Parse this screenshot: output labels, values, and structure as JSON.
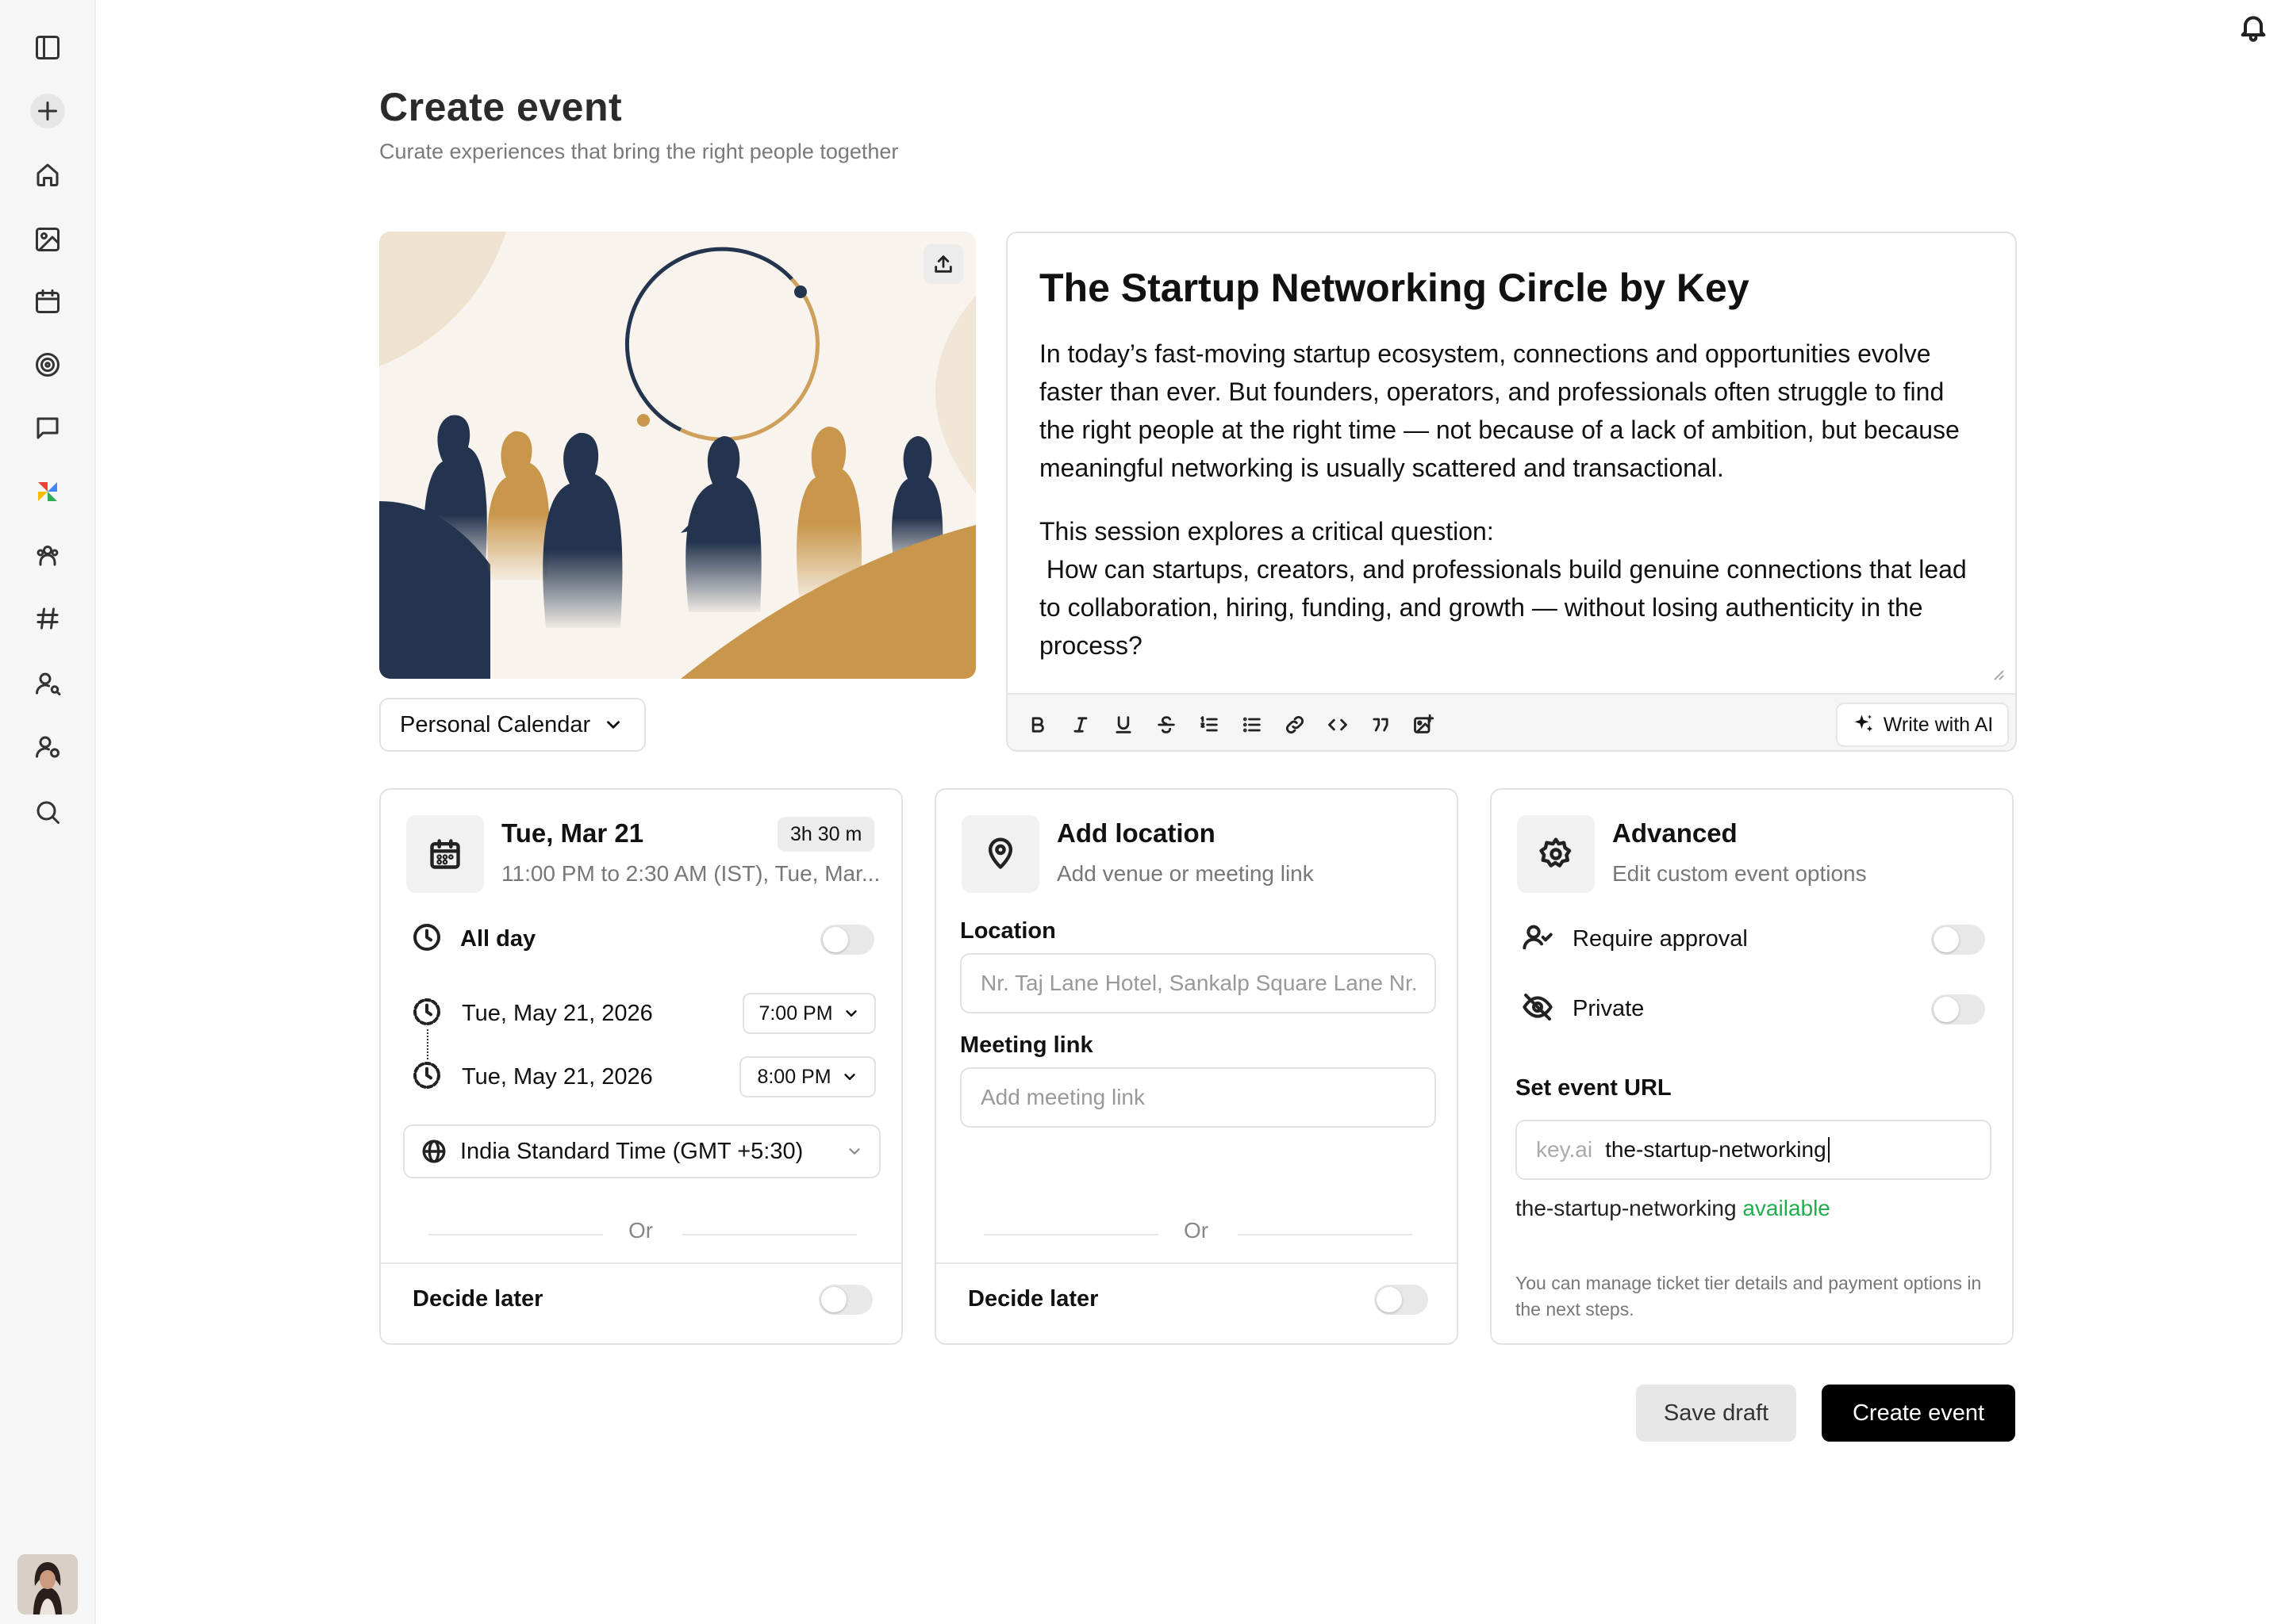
{
  "sidebar": {
    "items": [
      {
        "icon": "sidebar-panel-icon"
      },
      {
        "icon": "plus-icon"
      },
      {
        "icon": "home-icon"
      },
      {
        "icon": "image-icon"
      },
      {
        "icon": "calendar-icon"
      },
      {
        "icon": "target-icon"
      },
      {
        "icon": "chat-icon"
      },
      {
        "icon": "apps-icon"
      },
      {
        "icon": "community-icon"
      },
      {
        "icon": "hashtag-icon"
      },
      {
        "icon": "user-search-icon"
      },
      {
        "icon": "user-settings-icon"
      },
      {
        "icon": "search-icon"
      }
    ]
  },
  "header": {
    "title": "Create event",
    "subtitle": "Curate experiences that bring the right people together"
  },
  "calendar_select": {
    "value": "Personal Calendar"
  },
  "editor": {
    "title": "The Startup Networking Circle by Key",
    "paragraphs": [
      "In today’s fast-moving startup ecosystem, connections and opportunities evolve faster than ever. But founders, operators, and professionals often struggle to find the right people at the right time — not because of a lack of ambition, but because meaningful networking is usually scattered and transactional.",
      "This session explores a critical question:\n How can startups, creators, and professionals build genuine connections that lead to collaboration, hiring, funding, and growth — without losing authenticity in the process?"
    ],
    "ai_button": "Write with AI"
  },
  "datetime": {
    "heading": "Tue, Mar 21",
    "summary": "11:00 PM to 2:30 AM (IST), Tue, Mar...",
    "duration": "3h 30 m",
    "all_day_label": "All day",
    "start_date": "Tue, May 21, 2026",
    "start_time": "7:00 PM",
    "end_date": "Tue, May 21, 2026",
    "end_time": "8:00 PM",
    "timezone": "India Standard Time (GMT +5:30)",
    "or_label": "Or",
    "decide_later": "Decide later"
  },
  "location": {
    "heading": "Add location",
    "subtitle": "Add venue or meeting link",
    "location_label": "Location",
    "location_placeholder": "Nr. Taj Lane Hotel, Sankalp Square Lane Nr.",
    "meeting_label": "Meeting link",
    "meeting_placeholder": "Add meeting link",
    "or_label": "Or",
    "decide_later": "Decide later"
  },
  "advanced": {
    "heading": "Advanced",
    "subtitle": "Edit custom event options",
    "require_approval": "Require approval",
    "private": "Private",
    "url_label": "Set event URL",
    "url_prefix": "key.ai",
    "url_value": "the-startup-networking",
    "availability_slug": "the-startup-networking",
    "availability_status": "available",
    "note": "You can manage ticket tier details and payment options in the next steps."
  },
  "actions": {
    "save_draft": "Save draft",
    "create_event": "Create event"
  },
  "colors": {
    "accent": "#000000",
    "available": "#1fae4e",
    "cover_navy": "#24344f",
    "cover_gold": "#c9974b"
  }
}
